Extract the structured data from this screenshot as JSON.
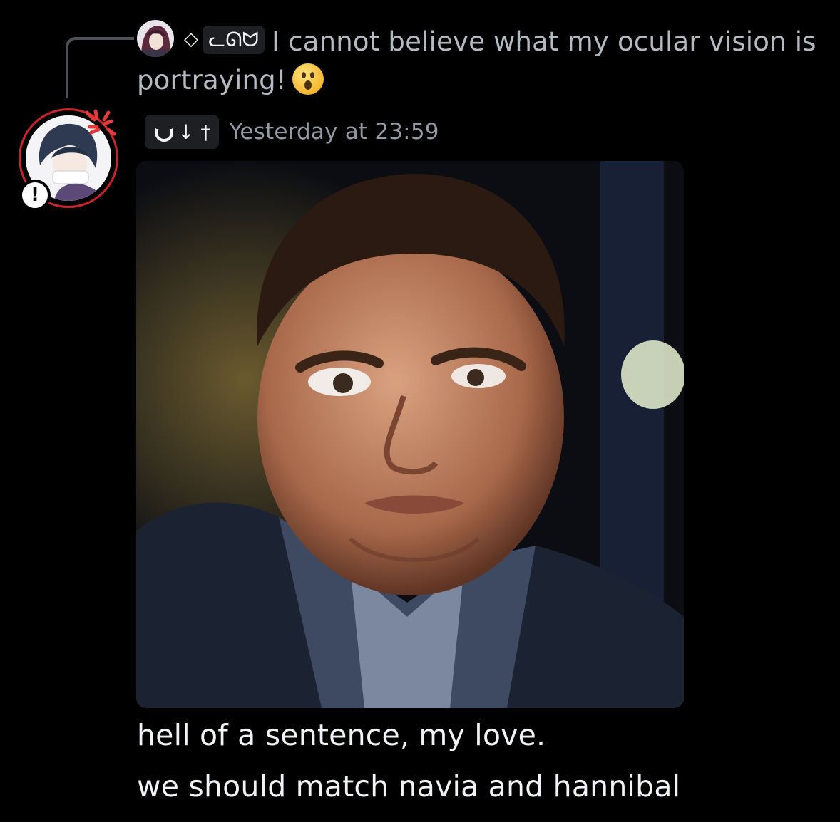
{
  "reply": {
    "author_prefix": "◇",
    "author_tag": "ᓚᘏᗢ",
    "text": "I cannot believe what my ocular vision is portraying!",
    "emoji_icon": "astonished-face-emoji"
  },
  "message": {
    "author_tag": "↓ †",
    "timestamp": "Yesterday at 23:59",
    "avatar_badge": "!",
    "attachment_icon": "meme-image",
    "lines": [
      "hell of a sentence, my love.",
      "we should match navia and hannibal"
    ]
  },
  "colors": {
    "background": "#000000",
    "text_primary": "#f2f3f5",
    "text_muted": "#949ba4",
    "reply_text": "#b5bac1",
    "avatar_ring": "#c9242b",
    "pill_bg": "#1e1f22"
  }
}
